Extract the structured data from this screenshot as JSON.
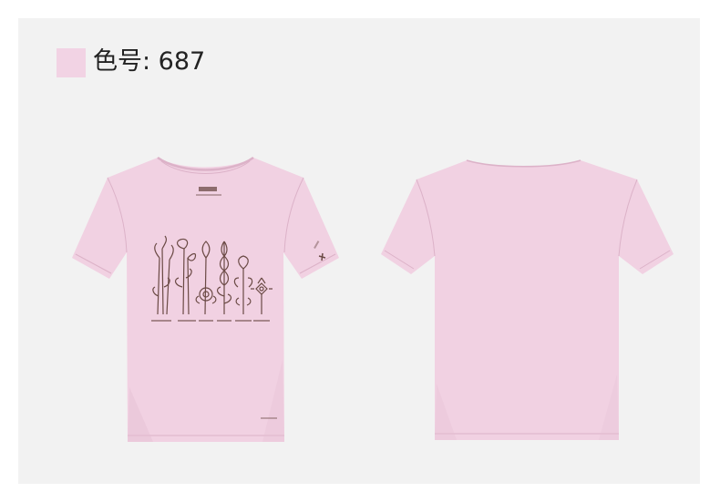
{
  "color_info": {
    "label": "色号: 687",
    "swatch_color": "#f2d3e4"
  },
  "colors": {
    "shirt": "#f1d1e2",
    "shirt_shadow": "#e5bfd3",
    "seam": "#dcb2c8",
    "print": "#6b4a45",
    "panel_bg": "#f2f2f2"
  },
  "images": {
    "front": "t-shirt-front-botanical-print",
    "back": "t-shirt-back-plain"
  }
}
